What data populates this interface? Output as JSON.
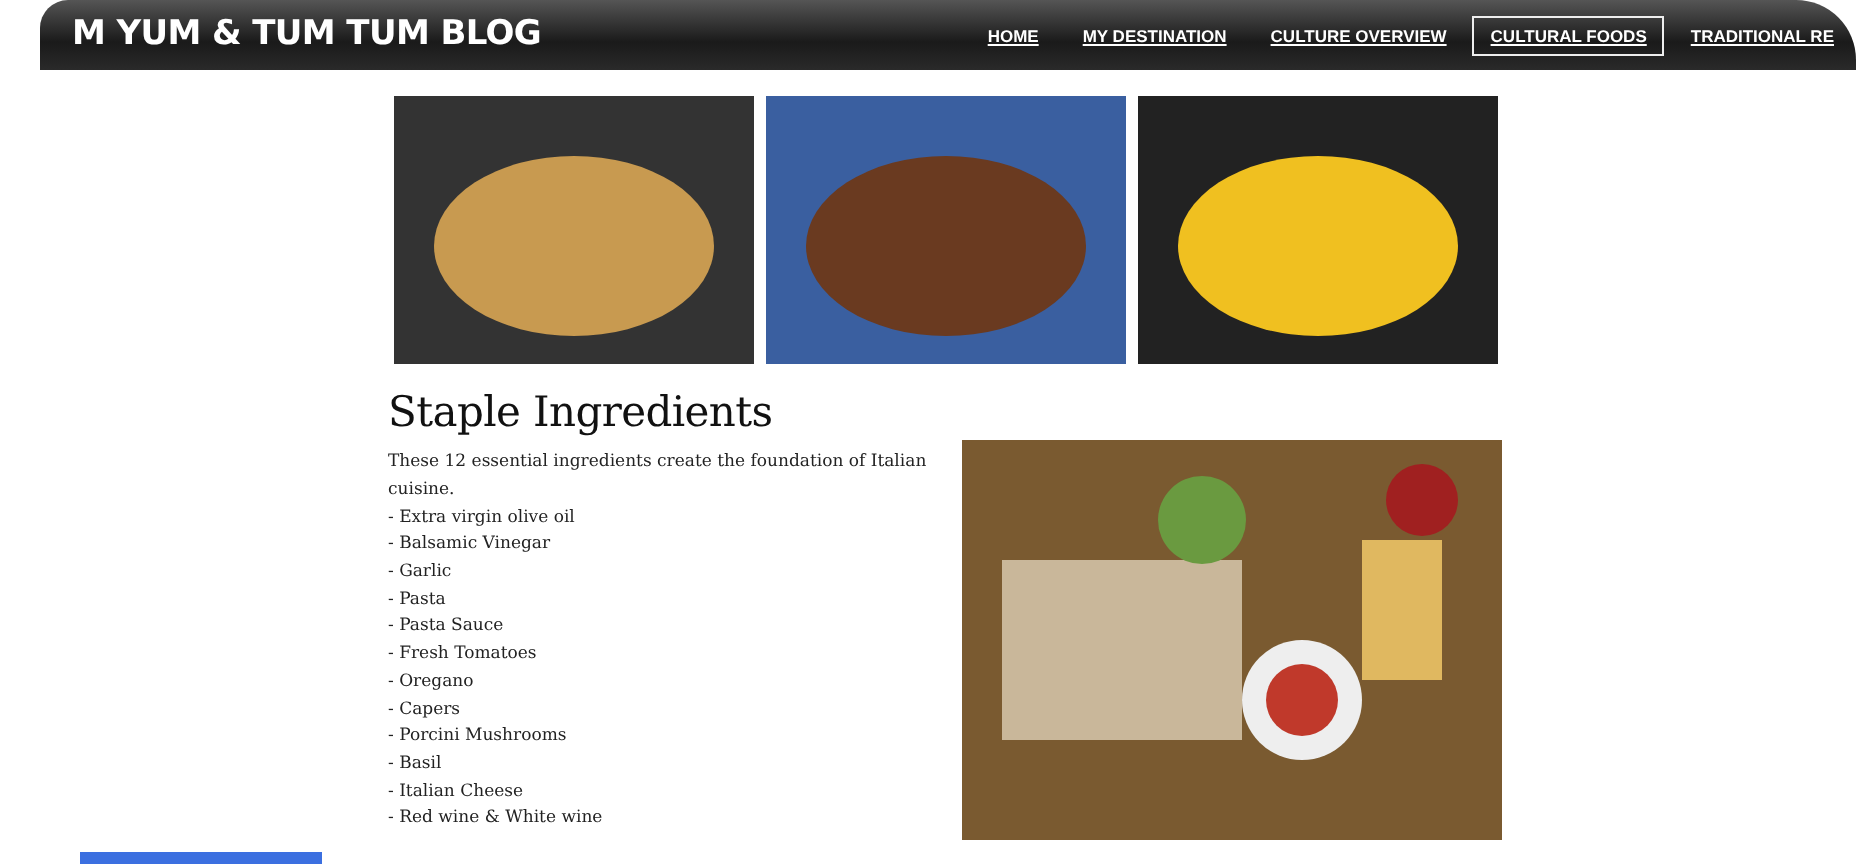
{
  "header": {
    "brand": "M YUM & TUM TUM BLOG",
    "nav": [
      {
        "label": "HOME",
        "selected": false
      },
      {
        "label": "MY DESTINATION",
        "selected": false
      },
      {
        "label": "CULTURE OVERVIEW",
        "selected": false
      },
      {
        "label": "CULTURAL FOODS",
        "selected": true
      },
      {
        "label": "TRADITIONAL RE",
        "selected": false
      }
    ]
  },
  "section": {
    "heading": "Staple Ingredients",
    "intro": "These 12 essential ingredients create the foundation of Italian cuisine.",
    "items": [
      "- Extra virgin olive oil",
      "- Balsamic Vinegar",
      "- Garlic",
      "- Pasta",
      "- Pasta Sauce",
      "- Fresh Tomatoes",
      "- Oregano",
      "- Capers",
      "- Porcini Mushrooms",
      "- Basil",
      "- Italian Cheese",
      "- Red wine & White wine"
    ]
  }
}
